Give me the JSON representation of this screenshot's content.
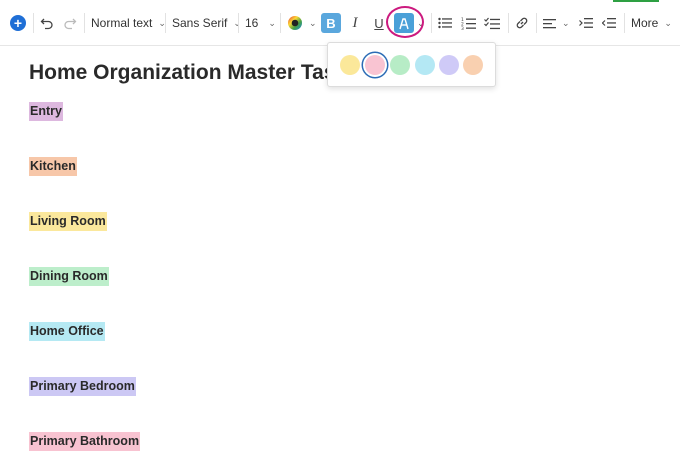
{
  "toolbar": {
    "insert_button": "+",
    "text_style": "Normal text",
    "font_family": "Sans Serif",
    "font_size": "16",
    "bold_label": "B",
    "italic_label": "I",
    "underline_label": "U",
    "more_label": "More"
  },
  "highlight_palette": {
    "swatches": [
      "#fbe89a",
      "#f9c4d2",
      "#b7ecc6",
      "#b4e8f4",
      "#cfcaf7",
      "#f9d0b0"
    ],
    "selected_index": 1
  },
  "document": {
    "title": "Home Organization Master Tas",
    "sections": [
      {
        "label": "Entry",
        "highlight": "#ddb8df"
      },
      {
        "label": "Kitchen",
        "highlight": "#f7c7a9"
      },
      {
        "label": "Living Room",
        "highlight": "#fbe89c"
      },
      {
        "label": "Dining Room",
        "highlight": "#bdeecb"
      },
      {
        "label": "Home Office",
        "highlight": "#b5e9f3"
      },
      {
        "label": "Primary Bedroom",
        "highlight": "#ccc8f4"
      },
      {
        "label": "Primary Bathroom",
        "highlight": "#f8c3d1"
      }
    ]
  }
}
